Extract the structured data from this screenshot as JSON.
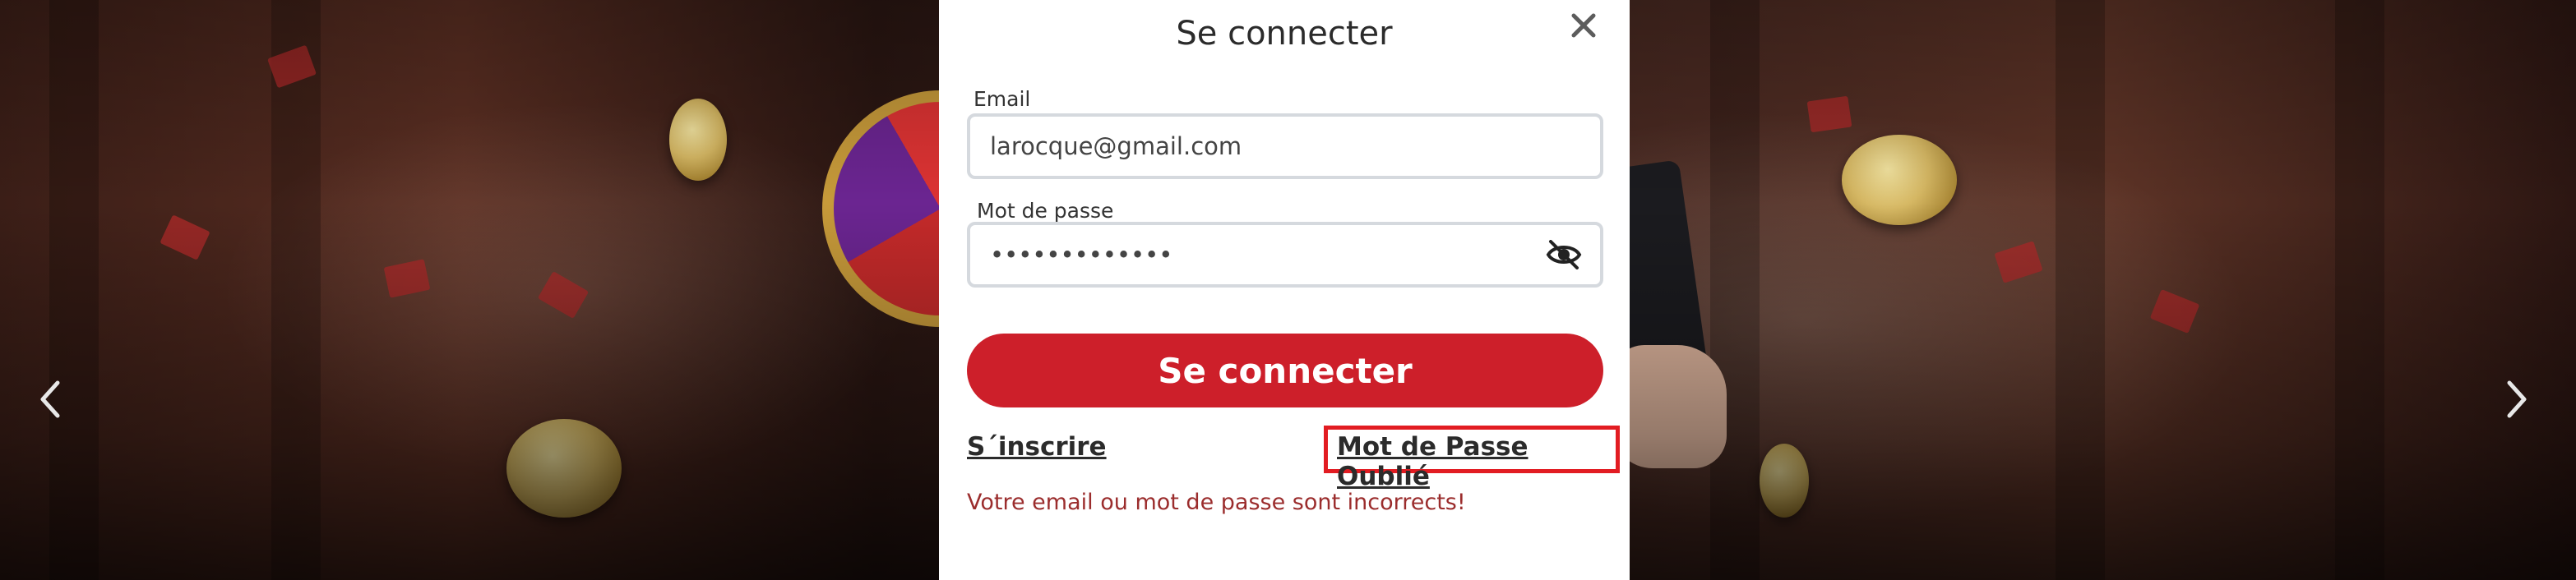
{
  "modal": {
    "title": "Se connecter",
    "close_icon": "close-icon",
    "email": {
      "label": "Email",
      "value": "larocque@gmail.com"
    },
    "password": {
      "label": "Mot de passe",
      "value": "•••••••••••••",
      "toggle_icon": "eye-off-icon"
    },
    "submit_label": "Se connecter",
    "register_label": "S´inscrire",
    "forgot_label": "Mot de Passe Oublié",
    "error_message": "Votre email ou mot de passe sont incorrects!"
  },
  "carousel": {
    "prev_icon": "chevron-left-icon",
    "next_icon": "chevron-right-icon"
  },
  "colors": {
    "accent": "#cd1f2a",
    "highlight": "#e21c22",
    "error": "#9b2d2d"
  }
}
